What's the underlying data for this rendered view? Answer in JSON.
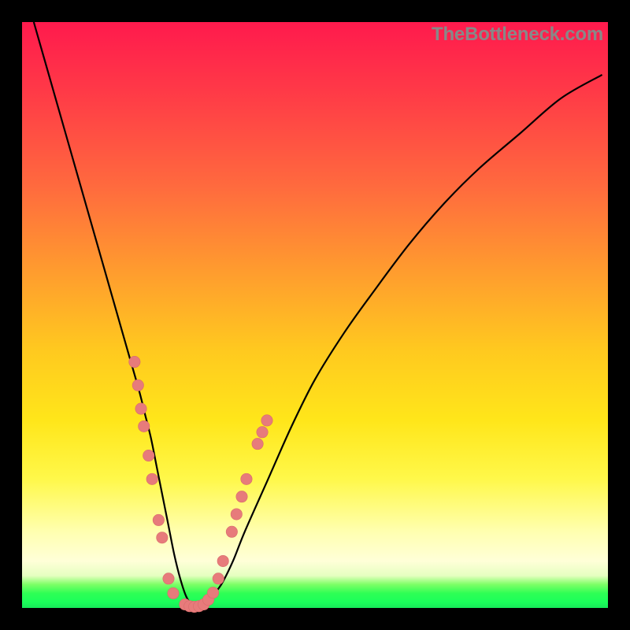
{
  "watermark": "TheBottleneck.com",
  "chart_data": {
    "type": "line",
    "title": "",
    "xlabel": "",
    "ylabel": "",
    "xlim": [
      0,
      100
    ],
    "ylim": [
      0,
      100
    ],
    "series": [
      {
        "name": "bottleneck-curve",
        "x": [
          2,
          4,
          6,
          8,
          10,
          12,
          14,
          16,
          18,
          20,
          21,
          22,
          23,
          24,
          25,
          26,
          27,
          28,
          29,
          30,
          31,
          32,
          34,
          36,
          38,
          42,
          46,
          50,
          55,
          60,
          66,
          72,
          78,
          85,
          92,
          99
        ],
        "y": [
          100,
          93,
          86,
          79,
          72,
          65,
          58,
          51,
          44,
          37,
          33,
          29,
          24,
          19,
          14,
          9,
          5,
          2,
          0.5,
          0,
          0.5,
          1.5,
          4,
          8,
          13,
          22,
          31,
          39,
          47,
          54,
          62,
          69,
          75,
          81,
          87,
          91
        ]
      }
    ],
    "scatter": {
      "name": "highlight-dots",
      "points": [
        [
          19.2,
          42
        ],
        [
          19.8,
          38
        ],
        [
          20.3,
          34
        ],
        [
          20.8,
          31
        ],
        [
          21.6,
          26
        ],
        [
          22.2,
          22
        ],
        [
          23.3,
          15
        ],
        [
          23.9,
          12
        ],
        [
          25.0,
          5
        ],
        [
          25.8,
          2.5
        ],
        [
          27.8,
          0.6
        ],
        [
          28.6,
          0.3
        ],
        [
          29.4,
          0.2
        ],
        [
          30.2,
          0.3
        ],
        [
          31.0,
          0.6
        ],
        [
          31.8,
          1.4
        ],
        [
          32.6,
          2.6
        ],
        [
          33.5,
          5
        ],
        [
          34.3,
          8
        ],
        [
          35.8,
          13
        ],
        [
          36.6,
          16
        ],
        [
          37.5,
          19
        ],
        [
          38.3,
          22
        ],
        [
          40.2,
          28
        ],
        [
          41.0,
          30
        ],
        [
          41.8,
          32
        ]
      ]
    },
    "background_gradient": {
      "top": "#ff1a4d",
      "mid": "#ffe61a",
      "bottom": "#17e85a"
    }
  }
}
